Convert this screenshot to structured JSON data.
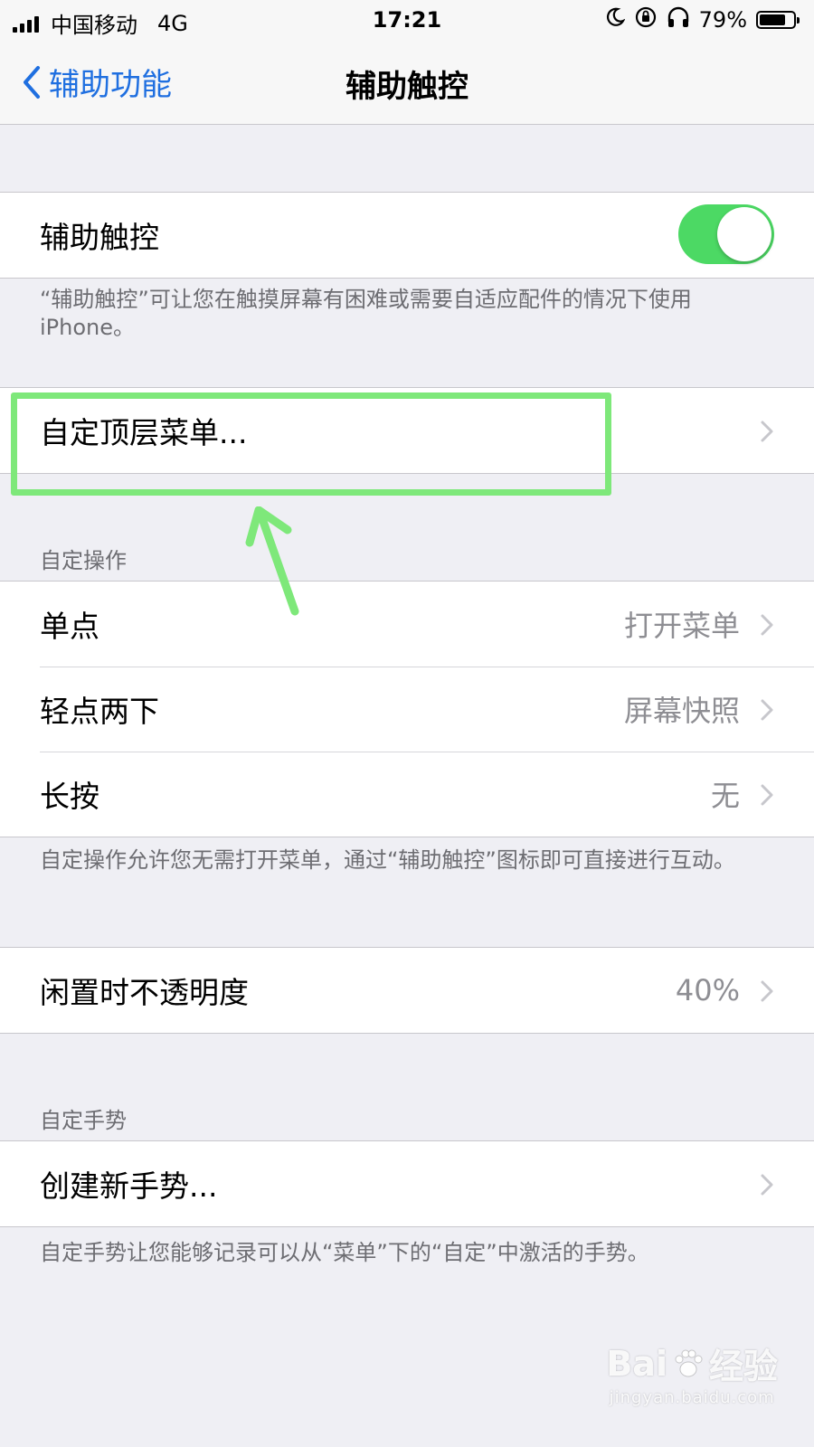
{
  "status_bar": {
    "carrier": "中国移动",
    "network": "4G",
    "time": "17:21",
    "battery_percent": "79%",
    "battery_level": 0.79,
    "icons": [
      "signal-icon",
      "moon-icon",
      "orientation-lock-icon",
      "headphones-icon",
      "battery-icon"
    ]
  },
  "nav": {
    "back_label": "辅助功能",
    "title": "辅助触控"
  },
  "assistive_touch": {
    "label": "辅助触控",
    "enabled": true,
    "note": "“辅助触控”可让您在触摸屏幕有困难或需要自适应配件的情况下使用 iPhone。"
  },
  "customize_menu": {
    "label": "自定顶层菜单..."
  },
  "custom_actions": {
    "header": "自定操作",
    "rows": [
      {
        "label": "单点",
        "value": "打开菜单"
      },
      {
        "label": "轻点两下",
        "value": "屏幕快照"
      },
      {
        "label": "长按",
        "value": "无"
      }
    ],
    "note": "自定操作允许您无需打开菜单，通过“辅助触控”图标即可直接进行互动。"
  },
  "idle_opacity": {
    "label": "闲置时不透明度",
    "value": "40%"
  },
  "custom_gestures": {
    "header": "自定手势",
    "create_label": "创建新手势...",
    "note": "自定手势让您能够记录可以从“菜单”下的“自定”中激活的手势。"
  },
  "watermark": {
    "brand": "Bai",
    "brand_suffix": "经验",
    "url": "jingyan.baidu.com"
  },
  "colors": {
    "accent": "#1f6fe0",
    "toggle_on": "#4cd964",
    "annotation": "#7ee87a",
    "background": "#efeff4"
  }
}
